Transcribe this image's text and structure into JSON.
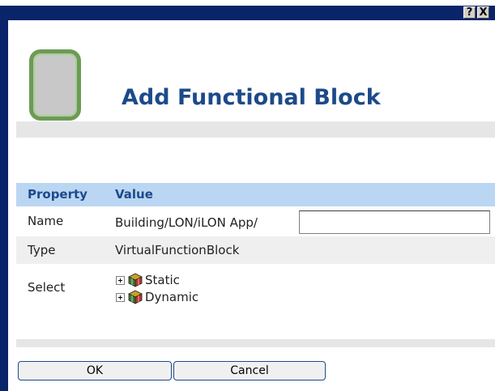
{
  "window": {
    "help_glyph": "?",
    "close_glyph": "X"
  },
  "header": {
    "title": "Add Functional Block"
  },
  "grid": {
    "columns": [
      "Property",
      "Value"
    ],
    "rows": {
      "name": {
        "label": "Name",
        "value": "Building/LON/iLON App/",
        "input_value": ""
      },
      "type": {
        "label": "Type",
        "value": "VirtualFunctionBlock"
      },
      "select": {
        "label": "Select",
        "tree": [
          {
            "label": "Static",
            "icon": "functional-block-icon",
            "expander": "expand-icon"
          },
          {
            "label": "Dynamic",
            "icon": "functional-block-icon",
            "expander": "expand-icon"
          }
        ]
      }
    }
  },
  "buttons": {
    "ok": "OK",
    "cancel": "Cancel"
  },
  "colors": {
    "titlebar": "#0a246a",
    "title_text": "#1c4a8a",
    "header_row": "#bbd6f3",
    "alt_row": "#efefef",
    "logo_border": "#6d9a57"
  }
}
